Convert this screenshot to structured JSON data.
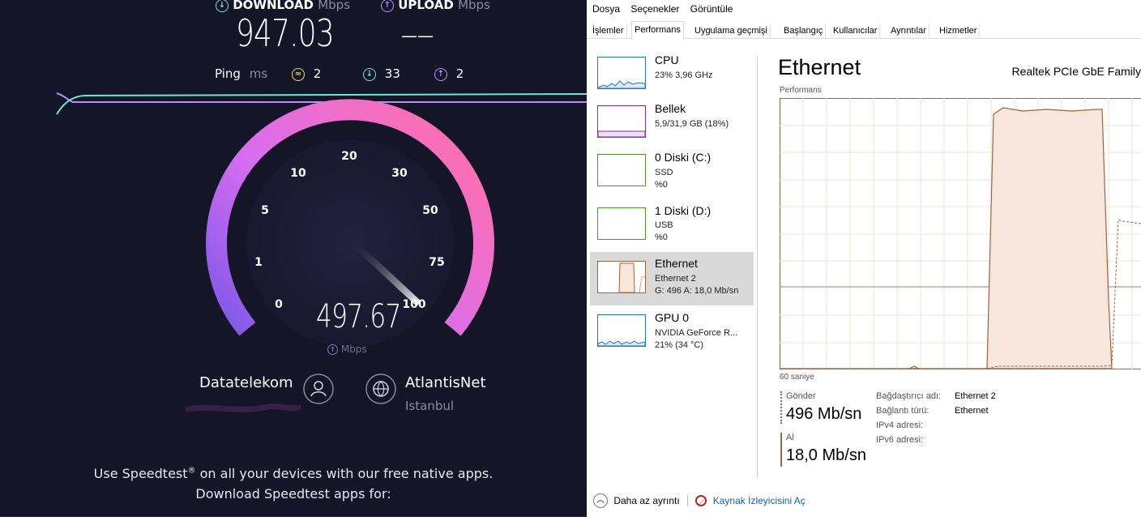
{
  "speedtest": {
    "download": {
      "label": "DOWNLOAD",
      "unit": "Mbps",
      "value": "947.03"
    },
    "upload": {
      "label": "UPLOAD",
      "unit": "Mbps",
      "value": "——"
    },
    "ping": {
      "label": "Ping",
      "unit": "ms",
      "idle": "2",
      "download": "33",
      "upload": "2"
    },
    "gauge": {
      "ticks": [
        "0",
        "1",
        "5",
        "10",
        "20",
        "30",
        "50",
        "75",
        "100"
      ],
      "current_value": "497.67",
      "unit": "Mbps",
      "needle_value": "100"
    },
    "provider": {
      "name": "Datatelekom"
    },
    "server": {
      "name": "AtlantisNet",
      "location": "Istanbul"
    },
    "promo": {
      "line1_pre": "Use Speedtest",
      "line1_sup": "®",
      "line1_post": " on all your devices with our free native apps.",
      "line2": "Download Speedtest apps for:"
    },
    "colors": {
      "background": "#141526",
      "gauge_start": "#8a5cf0",
      "gauge_end": "#ff6fae",
      "download_accent": "#6fe3d6",
      "upload_accent": "#b98cff",
      "idle_accent": "#f2d35b"
    }
  },
  "taskmanager": {
    "menu": [
      "Dosya",
      "Seçenekler",
      "Görüntüle"
    ],
    "tabs": [
      "İşlemler",
      "Performans",
      "Uygulama geçmişi",
      "Başlangıç",
      "Kullanıcılar",
      "Ayrıntılar",
      "Hizmetler"
    ],
    "active_tab": "Performans",
    "sidebar": [
      {
        "title": "CPU",
        "sub1": "23% 3,96 GHz",
        "sub2": "",
        "sub3": ""
      },
      {
        "title": "Bellek",
        "sub1": "5,9/31,9 GB (18%)",
        "sub2": "",
        "sub3": ""
      },
      {
        "title": "0 Diski (C:)",
        "sub1": "SSD",
        "sub2": "%0",
        "sub3": ""
      },
      {
        "title": "1 Diski (D:)",
        "sub1": "USB",
        "sub2": "%0",
        "sub3": ""
      },
      {
        "title": "Ethernet",
        "sub1": "Ethernet 2",
        "sub2": "G: 496 A: 18,0 Mb/sn",
        "sub3": ""
      },
      {
        "title": "GPU 0",
        "sub1": "NVIDIA GeForce R...",
        "sub2": "21% (34 °C)",
        "sub3": ""
      }
    ],
    "selected_item": "Ethernet",
    "main": {
      "title": "Ethernet",
      "adapter_name": "Realtek PCIe GbE Family",
      "graph_label": "Performans",
      "time_label": "60 saniye",
      "send_label": "Gönder",
      "send_value": "496 Mb/sn",
      "receive_label": "Al",
      "receive_value": "18,0 Mb/sn",
      "details": [
        {
          "key": "Bağdaştırıcı adı:",
          "value": "Ethernet 2"
        },
        {
          "key": "Bağlantı türü:",
          "value": "Ethernet"
        },
        {
          "key": "IPv4 adresi:",
          "value": ""
        },
        {
          "key": "IPv6 adresi:",
          "value": ""
        }
      ]
    },
    "footer": {
      "less_details": "Daha az ayrıntı",
      "resource_monitor": "Kaynak İzleyicisini Aç"
    },
    "colors": {
      "ethernet": "#a0643c",
      "cpu": "#1f7cb8",
      "memory": "#8b2fa3",
      "disk": "#4d9a2a",
      "gpu": "#1f7cb8"
    }
  }
}
